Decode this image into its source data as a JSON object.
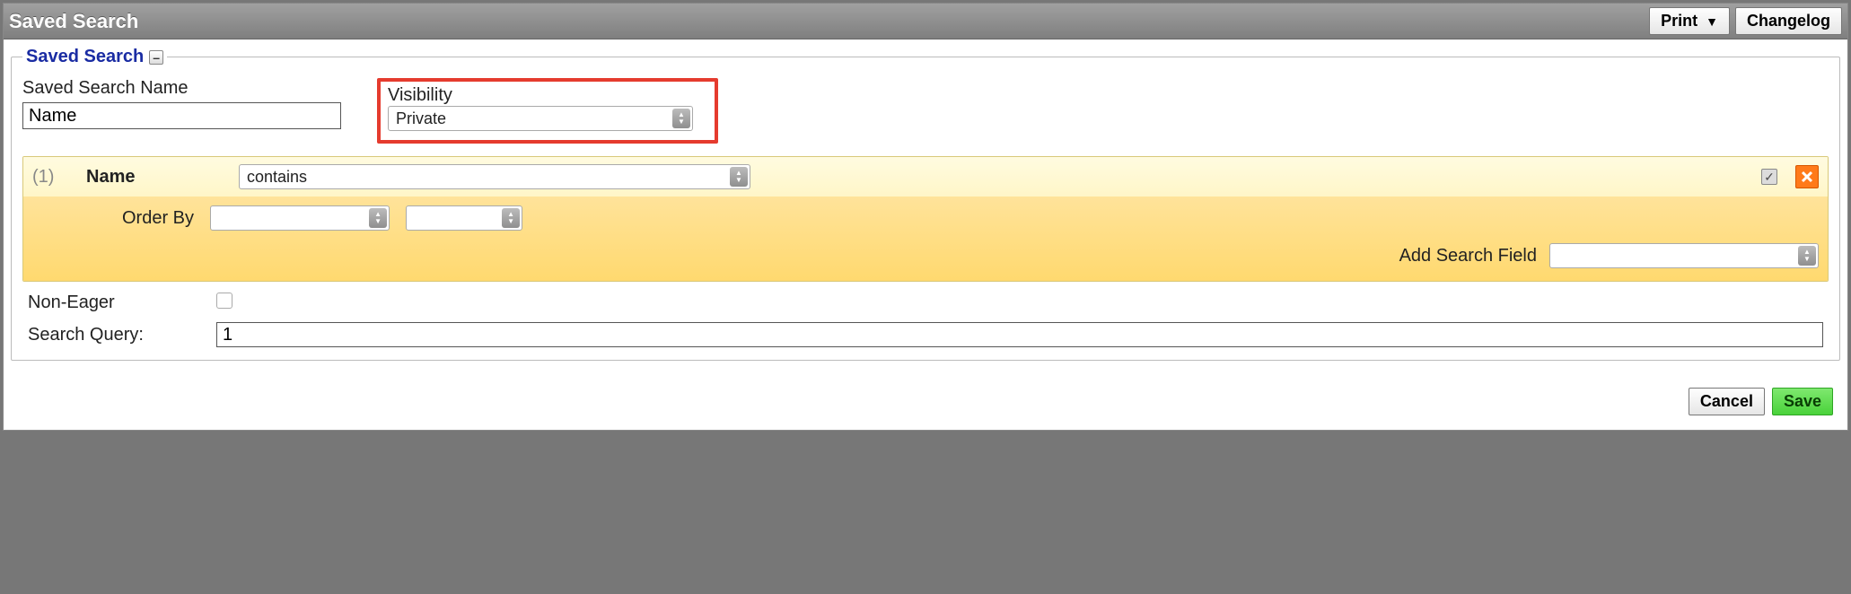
{
  "titlebar": {
    "title": "Saved Search",
    "print_label": "Print",
    "changelog_label": "Changelog"
  },
  "fieldset": {
    "legend": "Saved Search",
    "collapse_glyph": "–"
  },
  "name_field": {
    "label": "Saved Search Name",
    "value": "Name"
  },
  "visibility": {
    "label": "Visibility",
    "value": "Private"
  },
  "criteria": {
    "index": "(1)",
    "field": "Name",
    "operator": "contains",
    "checked_glyph": "✓",
    "orderby_label": "Order By",
    "orderby1": "",
    "orderby2": "",
    "addfield_label": "Add Search Field",
    "addfield_value": ""
  },
  "noneager": {
    "label": "Non-Eager",
    "checked": false
  },
  "query": {
    "label": "Search Query:",
    "value": "1"
  },
  "footer": {
    "cancel": "Cancel",
    "save": "Save"
  }
}
